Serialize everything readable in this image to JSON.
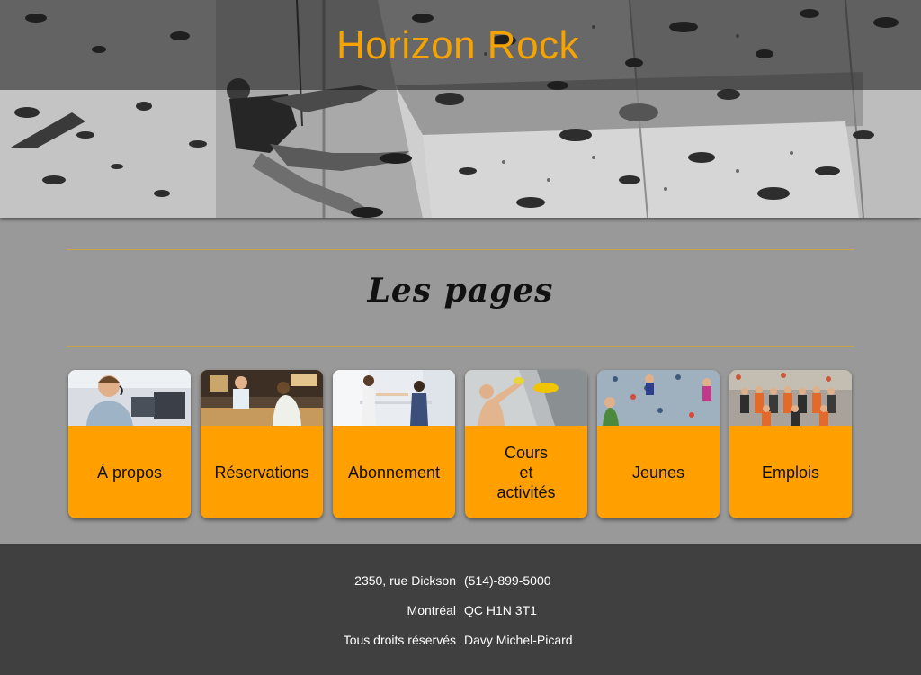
{
  "header": {
    "site_title": "Horizon Rock",
    "hero_image": "black-and-white rock climber on indoor climbing wall"
  },
  "section": {
    "title": "Les pages"
  },
  "cards": [
    {
      "label_lines": [
        "À propos"
      ],
      "image": "customer-service agent with headset"
    },
    {
      "label_lines": [
        "Réservations"
      ],
      "image": "hotel reception desk"
    },
    {
      "label_lines": [
        "Abonnement"
      ],
      "image": "office handshake"
    },
    {
      "label_lines": [
        "Cours",
        "et",
        "activités"
      ],
      "image": "climber on wall"
    },
    {
      "label_lines": [
        "Jeunes"
      ],
      "image": "kids on climbing wall"
    },
    {
      "label_lines": [
        "Emplois"
      ],
      "image": "group photo of staff"
    }
  ],
  "footer": {
    "rows": [
      {
        "left": "2350, rue Dickson",
        "right": "(514)-899-5000"
      },
      {
        "left": "Montréal",
        "right": "QC H1N 3T1"
      },
      {
        "left": "Tous droits réservés",
        "right": "Davy Michel-Picard"
      }
    ]
  },
  "colors": {
    "accent": "#f5a300",
    "card": "#ff9f00",
    "page_bg": "#999999",
    "footer_bg": "#404040",
    "rule": "#c9a24c"
  }
}
